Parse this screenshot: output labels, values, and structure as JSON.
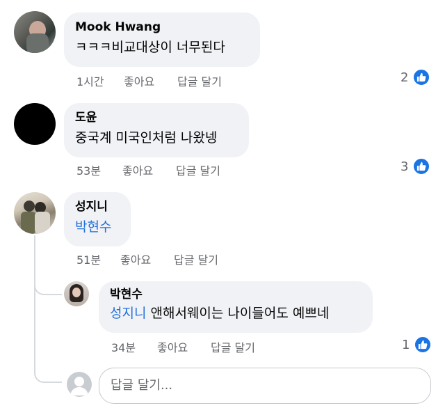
{
  "comments": [
    {
      "author": "Mook Hwang",
      "text": "ㅋㅋㅋ비교대상이 너무된다",
      "time": "1시간",
      "like_label": "좋아요",
      "reply_label": "답글 달기",
      "reactions": "2"
    },
    {
      "author": "도윤",
      "text": "중국계 미국인처럼 나왔넹",
      "time": "53분",
      "like_label": "좋아요",
      "reply_label": "답글 달기",
      "reactions": "3"
    },
    {
      "author": "성지니",
      "mention": "박현수",
      "time": "51분",
      "like_label": "좋아요",
      "reply_label": "답글 달기"
    }
  ],
  "reply": {
    "author": "박현수",
    "mention": "성지니",
    "text": " 앤해서웨이는 나이들어도 예쁘네",
    "time": "34분",
    "like_label": "좋아요",
    "reply_label": "답글 달기",
    "reactions": "1"
  },
  "reply_box": {
    "placeholder": "답글 달기..."
  },
  "colors": {
    "like_blue": "#1b74e4",
    "mention_blue": "#216fdb",
    "bubble_bg": "#f0f2f5",
    "meta_gray": "#65676b"
  }
}
